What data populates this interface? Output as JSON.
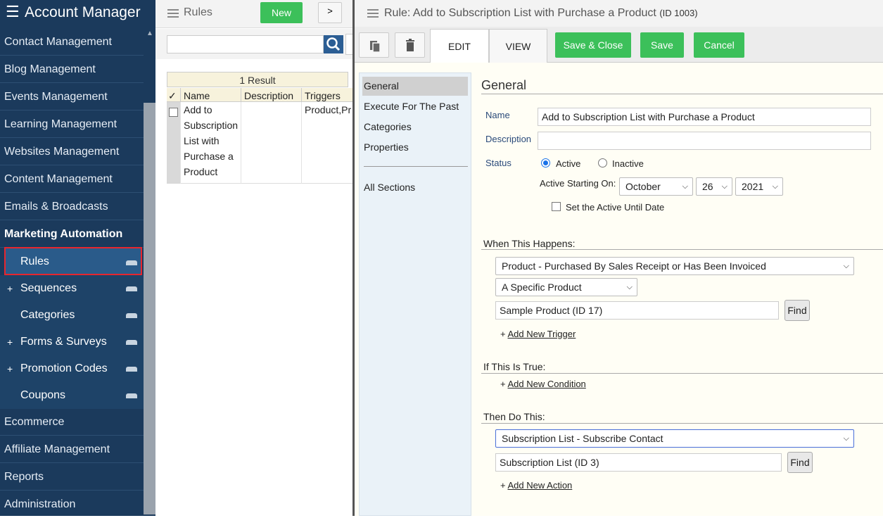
{
  "sidebar": {
    "app_title": "Account Manager",
    "items": [
      {
        "label": "Contact Management"
      },
      {
        "label": "Blog Management"
      },
      {
        "label": "Events Management"
      },
      {
        "label": "Learning Management"
      },
      {
        "label": "Websites Management"
      },
      {
        "label": "Content Management"
      },
      {
        "label": "Emails & Broadcasts"
      },
      {
        "label": "Marketing Automation"
      }
    ],
    "sub_items": [
      {
        "label": "Rules",
        "expand": ""
      },
      {
        "label": "Sequences",
        "expand": "+"
      },
      {
        "label": "Categories",
        "expand": ""
      },
      {
        "label": "Forms & Surveys",
        "expand": "+"
      },
      {
        "label": "Promotion Codes",
        "expand": "+"
      },
      {
        "label": "Coupons",
        "expand": ""
      }
    ],
    "bottom_items": [
      {
        "label": "Ecommerce"
      },
      {
        "label": "Affiliate Management"
      },
      {
        "label": "Reports"
      },
      {
        "label": "Administration"
      }
    ]
  },
  "list": {
    "title": "Rules",
    "new_label": "New",
    "expand_label": ">",
    "search_value": "",
    "result_count": "1 Result",
    "columns": [
      "✓",
      "Name",
      "Description",
      "Triggers"
    ],
    "rows": [
      {
        "name": [
          "Add to",
          "Subscription",
          "List with",
          "Purchase a",
          "Product"
        ],
        "description": "",
        "triggers": "Product,Pr"
      }
    ]
  },
  "editor": {
    "title": "Rule: Add to Subscription List with Purchase a Product",
    "title_id": "(ID 1003)",
    "tabs": {
      "edit": "EDIT",
      "view": "VIEW"
    },
    "buttons": {
      "save_close": "Save & Close",
      "save": "Save",
      "cancel": "Cancel"
    },
    "sections_nav": {
      "items": [
        "General",
        "Execute For The Past",
        "Categories",
        "Properties"
      ],
      "all": "All Sections"
    },
    "general": {
      "heading": "General",
      "name_label": "Name",
      "name_value": "Add to Subscription List with Purchase a Product",
      "description_label": "Description",
      "description_value": "",
      "status_label": "Status",
      "active_label": "Active",
      "inactive_label": "Inactive",
      "active_starting_label": "Active Starting On:",
      "month": "October",
      "day": "26",
      "year": "2021",
      "until_label": "Set the Active Until Date"
    },
    "when": {
      "heading": "When This Happens:",
      "trigger": "Product - Purchased By Sales Receipt or Has Been Invoiced",
      "scope": "A Specific Product",
      "product": "Sample Product (ID 17)",
      "find": "Find",
      "add_plus": "+",
      "add_label": "Add New Trigger"
    },
    "if": {
      "heading": "If This Is True:",
      "add_plus": "+",
      "add_label": "Add New Condition"
    },
    "then": {
      "heading": "Then Do This:",
      "action": "Subscription List - Subscribe Contact",
      "target": "Subscription List (ID 3)",
      "find": "Find",
      "add_plus": "+",
      "add_label": "Add New Action"
    }
  }
}
